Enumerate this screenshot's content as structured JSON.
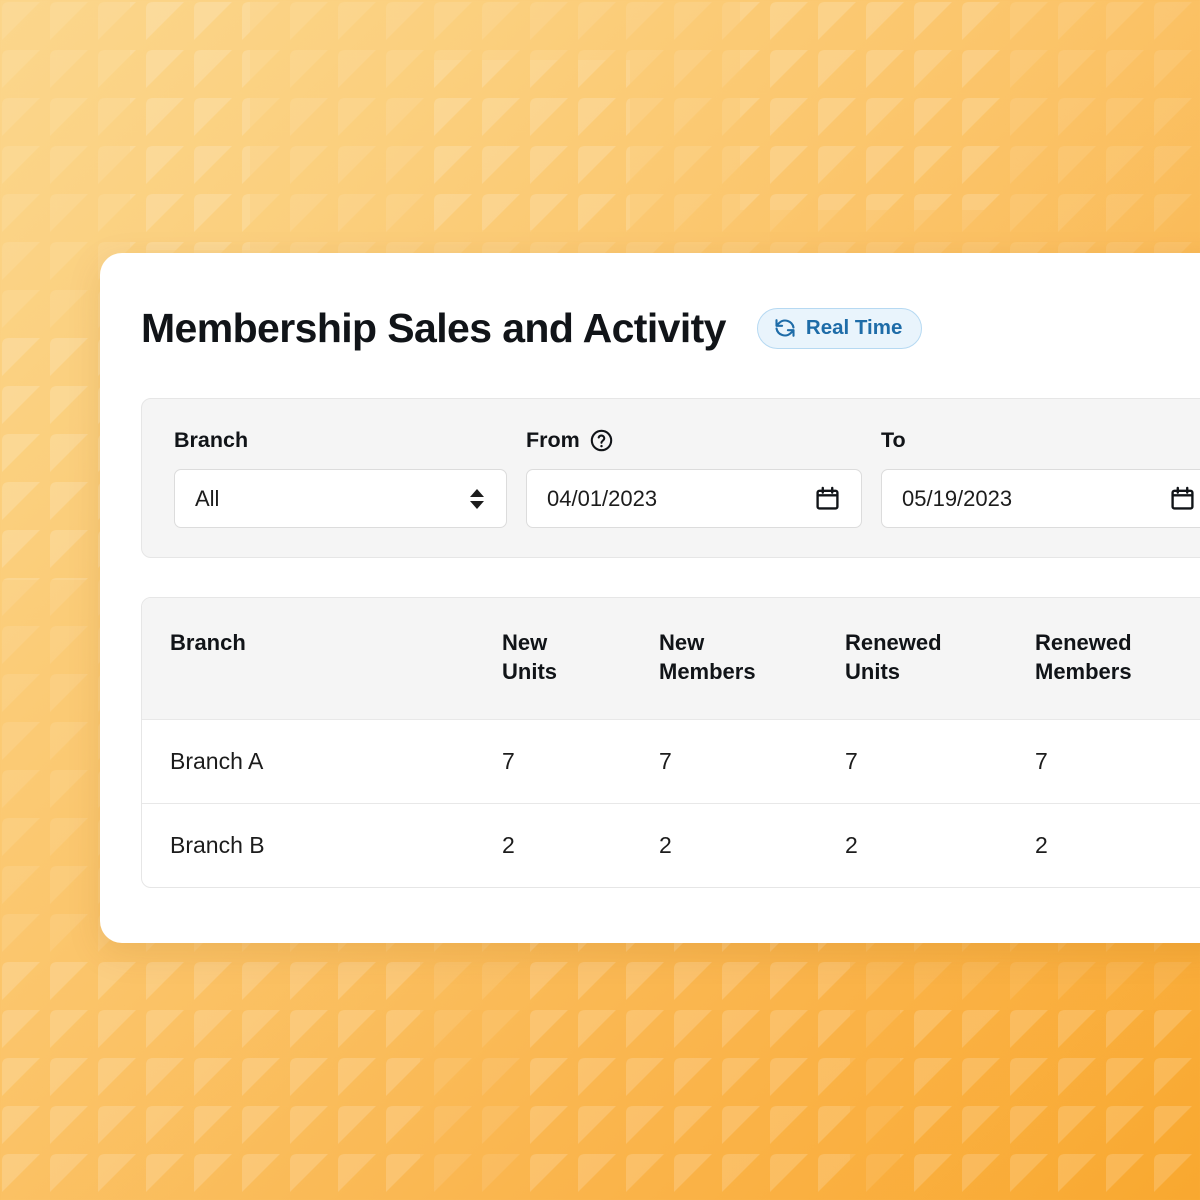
{
  "theme": {
    "bg_gradient_from": "#fbd68c",
    "bg_gradient_to": "#f9a82f",
    "card_bg": "#ffffff",
    "badge_bg": "#e9f4fc",
    "badge_border": "#b6d9f2",
    "badge_text": "#1e6ca8",
    "panel_bg": "#f5f5f5",
    "text_primary": "#111418",
    "border": "#e6e6e6"
  },
  "header": {
    "title": "Membership Sales and Activity",
    "badge": {
      "label": "Real Time",
      "icon": "refresh-sync-icon"
    }
  },
  "filters": {
    "branch": {
      "label": "Branch",
      "value": "All",
      "options": [
        "All"
      ],
      "icon": "stepper-arrows-icon"
    },
    "from": {
      "label": "From",
      "value": "04/01/2023",
      "placeholder": "mm/dd/yyyy",
      "help_icon": "question-circle-icon",
      "calendar_icon": "calendar-icon"
    },
    "to": {
      "label": "To",
      "value": "05/19/2023",
      "placeholder": "mm/dd/yyyy",
      "calendar_icon": "calendar-icon"
    }
  },
  "table": {
    "columns": [
      {
        "key": "branch",
        "line1": "Branch",
        "line2": ""
      },
      {
        "key": "new_units",
        "line1": "New",
        "line2": "Units"
      },
      {
        "key": "new_members",
        "line1": "New",
        "line2": "Members"
      },
      {
        "key": "renewed_units",
        "line1": "Renewed",
        "line2": "Units"
      },
      {
        "key": "renewed_members",
        "line1": "Renewed",
        "line2": "Members"
      }
    ],
    "rows": [
      {
        "branch": "Branch A",
        "new_units": "7",
        "new_members": "7",
        "renewed_units": "7",
        "renewed_members": "7"
      },
      {
        "branch": "Branch B",
        "new_units": "2",
        "new_members": "2",
        "renewed_units": "2",
        "renewed_members": "2"
      }
    ]
  }
}
